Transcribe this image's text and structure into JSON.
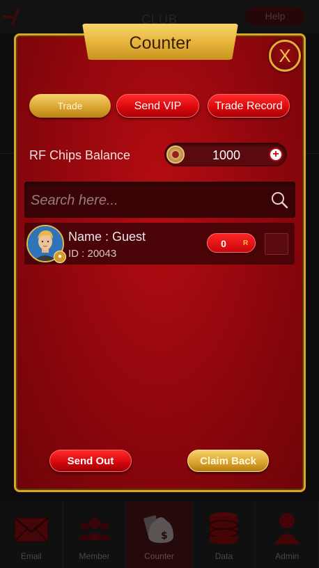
{
  "background": {
    "club_title": "CLUB",
    "help_label": "Help"
  },
  "modal": {
    "title": "Counter",
    "close_label": "X",
    "tabs": [
      {
        "label": "Trade",
        "active": true
      },
      {
        "label": "Send VIP",
        "active": false
      },
      {
        "label": "Trade Record",
        "active": false
      }
    ],
    "balance": {
      "label": "RF Chips Balance",
      "value": "1000",
      "add_label": "+"
    },
    "search": {
      "placeholder": "Search here...",
      "value": ""
    },
    "members": [
      {
        "name": "Name : Guest",
        "id": "ID : 20043",
        "amount": "0",
        "amount_unit": "R",
        "checked": false
      }
    ],
    "buttons": {
      "send_out": "Send Out",
      "claim_back": "Claim Back"
    }
  },
  "bottom_nav": [
    {
      "label": "Email",
      "icon": "envelope-icon",
      "active": false
    },
    {
      "label": "Member",
      "icon": "members-icon",
      "active": false
    },
    {
      "label": "Counter",
      "icon": "money-bag-icon",
      "active": true
    },
    {
      "label": "Data",
      "icon": "database-icon",
      "active": false
    },
    {
      "label": "Admin",
      "icon": "admin-user-icon",
      "active": false
    }
  ],
  "colors": {
    "accent_gold": "#d9a625",
    "accent_red": "#d8070b",
    "panel_red": "#8e070c"
  }
}
